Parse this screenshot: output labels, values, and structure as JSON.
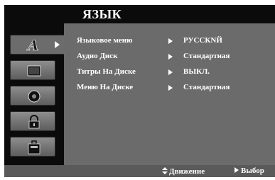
{
  "header": {
    "title": "ЯЗЫК"
  },
  "sidebar": {
    "tabs": [
      {
        "icon": "language-icon",
        "active": true
      },
      {
        "icon": "display-icon",
        "active": false
      },
      {
        "icon": "audio-icon",
        "active": false
      },
      {
        "icon": "lock-icon",
        "active": false
      },
      {
        "icon": "other-settings-icon",
        "active": false
      }
    ]
  },
  "menu": {
    "rows": [
      {
        "label": "Языковое меню",
        "value": "РУССКNЙ"
      },
      {
        "label": "Аудио Диск",
        "value": "Стандартная"
      },
      {
        "label": "Титры На Диске",
        "value": "ВЫКЛ."
      },
      {
        "label": "Меню На Диске",
        "value": "Стандартная"
      }
    ]
  },
  "footer": {
    "move_label": "Движение",
    "select_label": "Выбор"
  },
  "colors": {
    "background": "#0b0b0b",
    "panel": "#6b6b6b",
    "footer": "#5a5a5a",
    "text": "#ffffff"
  }
}
